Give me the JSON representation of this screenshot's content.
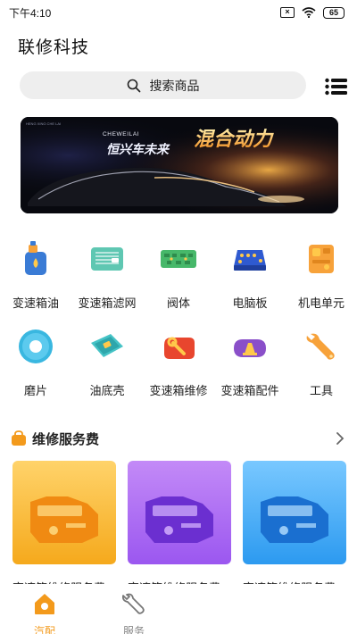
{
  "status_bar": {
    "time": "下午4:10",
    "battery": "65"
  },
  "header": {
    "title": "联修科技"
  },
  "search": {
    "placeholder": "搜索商品"
  },
  "banner": {
    "brand_small": "CHEWEILAI",
    "slogan_left": "恒兴车未来",
    "slogan_right": "混合动力",
    "tiny_text": "HENG XING CHE LAI"
  },
  "categories": [
    {
      "label": "变速箱油",
      "icon": "oil-bottle-icon"
    },
    {
      "label": "变速箱滤网",
      "icon": "filter-icon"
    },
    {
      "label": "阀体",
      "icon": "valve-body-icon"
    },
    {
      "label": "电脑板",
      "icon": "circuit-board-icon"
    },
    {
      "label": "机电单元",
      "icon": "mechatronic-unit-icon"
    },
    {
      "label": "磨片",
      "icon": "friction-disc-icon"
    },
    {
      "label": "油底壳",
      "icon": "oil-pan-icon"
    },
    {
      "label": "变速箱维修",
      "icon": "repair-wrench-icon"
    },
    {
      "label": "变速箱配件",
      "icon": "parts-icon"
    },
    {
      "label": "工具",
      "icon": "tool-icon"
    }
  ],
  "section": {
    "title": "维修服务费"
  },
  "service_cards": [
    {
      "title": "变速箱维修服务费",
      "theme": "#f5b21e"
    },
    {
      "title": "变速箱维修服务费",
      "theme": "#9b57f0"
    },
    {
      "title": "变速箱维修服务费",
      "theme": "#2c9af0"
    }
  ],
  "bottom_nav": [
    {
      "label": "汽配",
      "active": true,
      "color": "#f39a1c"
    },
    {
      "label": "服务",
      "active": false,
      "color": "#888888"
    }
  ]
}
